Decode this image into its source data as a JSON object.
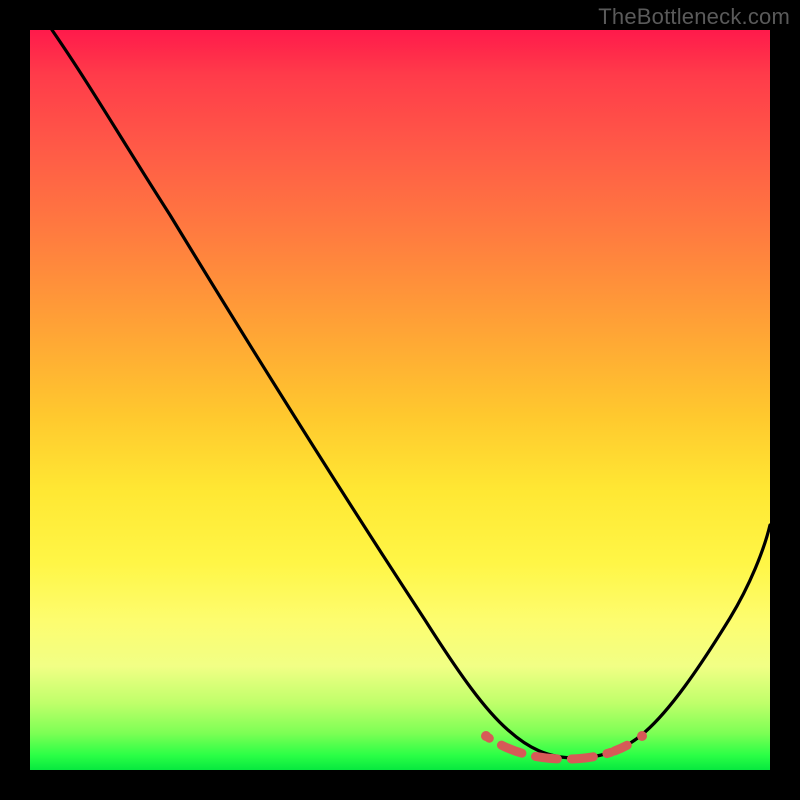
{
  "watermark": "TheBottleneck.com",
  "chart_data": {
    "type": "line",
    "title": "",
    "xlabel": "",
    "ylabel": "",
    "xlim": [
      0,
      100
    ],
    "ylim": [
      0,
      100
    ],
    "grid": false,
    "legend": false,
    "background": "rainbow-gradient (red top → green bottom)",
    "series": [
      {
        "name": "bottleneck-curve",
        "color": "#000000",
        "x": [
          3,
          8,
          14,
          20,
          28,
          36,
          44,
          52,
          57,
          61,
          64,
          67,
          70,
          73,
          76,
          79,
          81,
          84,
          88,
          92,
          96,
          100
        ],
        "y": [
          100,
          93,
          86,
          79,
          70,
          60,
          50,
          40,
          33,
          26,
          19,
          13,
          8,
          5,
          3,
          2,
          2,
          3,
          7,
          14,
          23,
          33
        ]
      }
    ],
    "annotations": [
      {
        "name": "optimal-range-marker",
        "type": "dashed-band",
        "color": "#d65a57",
        "x_range": [
          62,
          83
        ],
        "y": 3
      }
    ]
  }
}
